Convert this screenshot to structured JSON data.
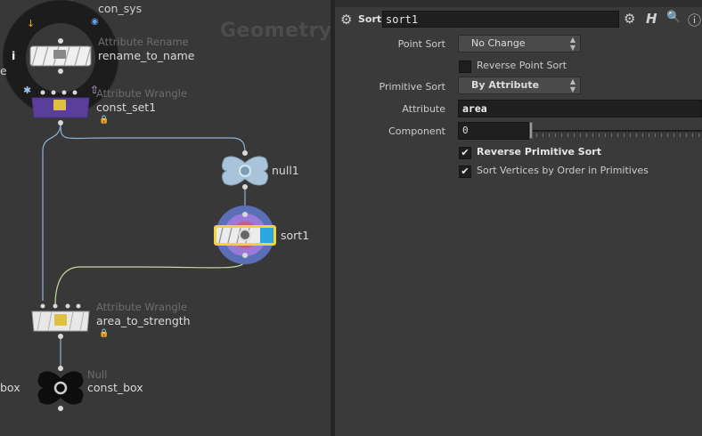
{
  "network": {
    "context_label": "Geometry",
    "nodes": {
      "top_partial_name": "con_sys",
      "rename_type": "Attribute Rename",
      "rename_name": "rename_to_name",
      "wrangle1_type": "Attribute Wrangle",
      "wrangle1_name": "const_set1",
      "null1_name": "null1",
      "sort_name": "sort1",
      "wrangle2_type": "Attribute Wrangle",
      "wrangle2_name": "area_to_strength",
      "null_type": "Null",
      "null_name": "const_box",
      "left_partial_name": "box",
      "left_partial_e": "e"
    },
    "lock_icon": "lock-icon",
    "radial_menu_info": "i"
  },
  "params": {
    "node_type": "Sort",
    "node_name": "sort1",
    "header_icons": [
      "gear-icon",
      "help-h-icon",
      "search-icon",
      "info-icon"
    ],
    "point_sort_label": "Point Sort",
    "point_sort_value": "No Change",
    "reverse_point_sort_label": "Reverse Point Sort",
    "reverse_point_sort_checked": false,
    "primitive_sort_label": "Primitive Sort",
    "primitive_sort_value": "By Attribute",
    "attribute_label": "Attribute",
    "attribute_value": "area",
    "component_label": "Component",
    "component_value": "0",
    "reverse_primitive_sort_label": "Reverse Primitive Sort",
    "reverse_primitive_sort_checked": true,
    "sort_vertices_label": "Sort Vertices by Order in Primitives",
    "sort_vertices_checked": true,
    "check_glyph": "✔",
    "gear_glyph": "⚙",
    "help_glyph": "H",
    "search_glyph": "🔍",
    "info_glyph": "ⓘ",
    "menu_arrow_glyph": "▲▼"
  },
  "colors": {
    "selected_outline": "#f3d23a",
    "sort_accent": "#2aa7e0",
    "wrangle_purple": "#5a3f9a",
    "null_blue": "#a9c4da"
  }
}
